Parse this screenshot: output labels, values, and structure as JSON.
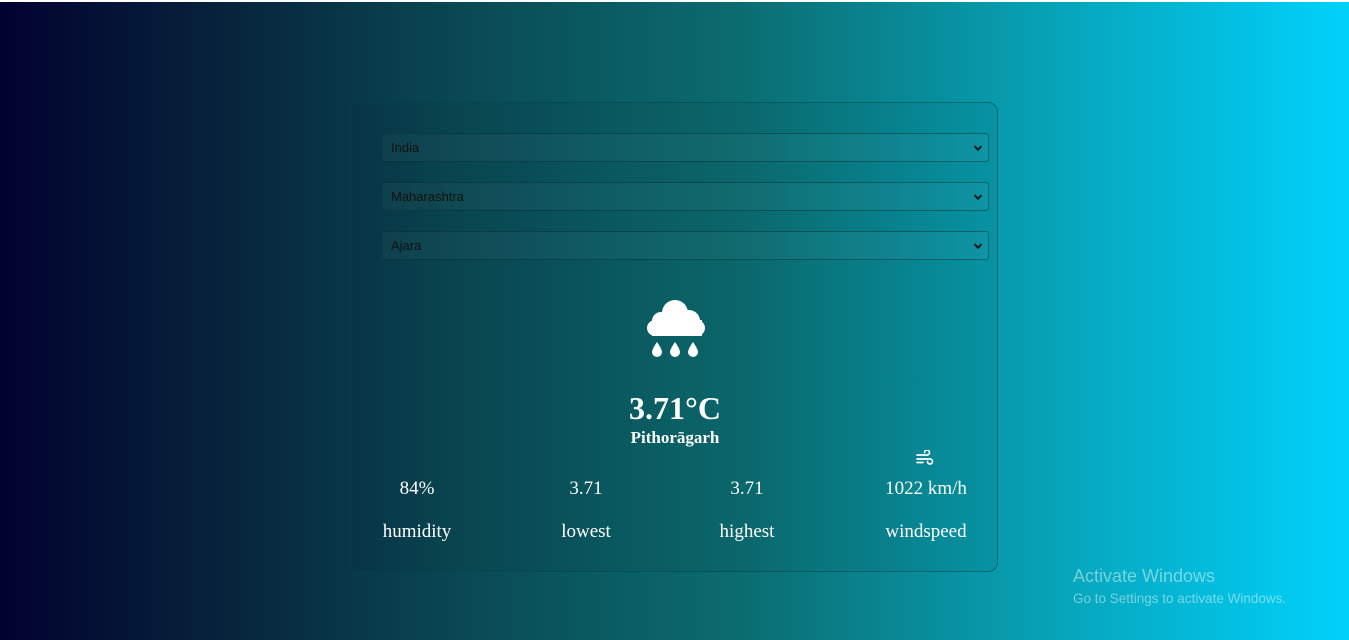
{
  "selects": {
    "country": "India",
    "state": "Maharashtra",
    "city": "Ajara"
  },
  "weather": {
    "icon": "cloud-rain-icon",
    "temperature": "3.71°C",
    "location": "Pithorāgarh"
  },
  "stats": {
    "humidity": {
      "value": "84%",
      "label": "humidity"
    },
    "lowest": {
      "value": "3.71",
      "label": "lowest"
    },
    "highest": {
      "value": "3.71",
      "label": "highest"
    },
    "windspeed": {
      "value": "1022 km/h",
      "label": "windspeed",
      "icon": "wind-icon"
    }
  },
  "watermark": {
    "title": "Activate Windows",
    "subtitle": "Go to Settings to activate Windows."
  },
  "colors": {
    "gradient_start": "#020230",
    "gradient_end": "#00d2fc",
    "text": "#ffffff"
  }
}
